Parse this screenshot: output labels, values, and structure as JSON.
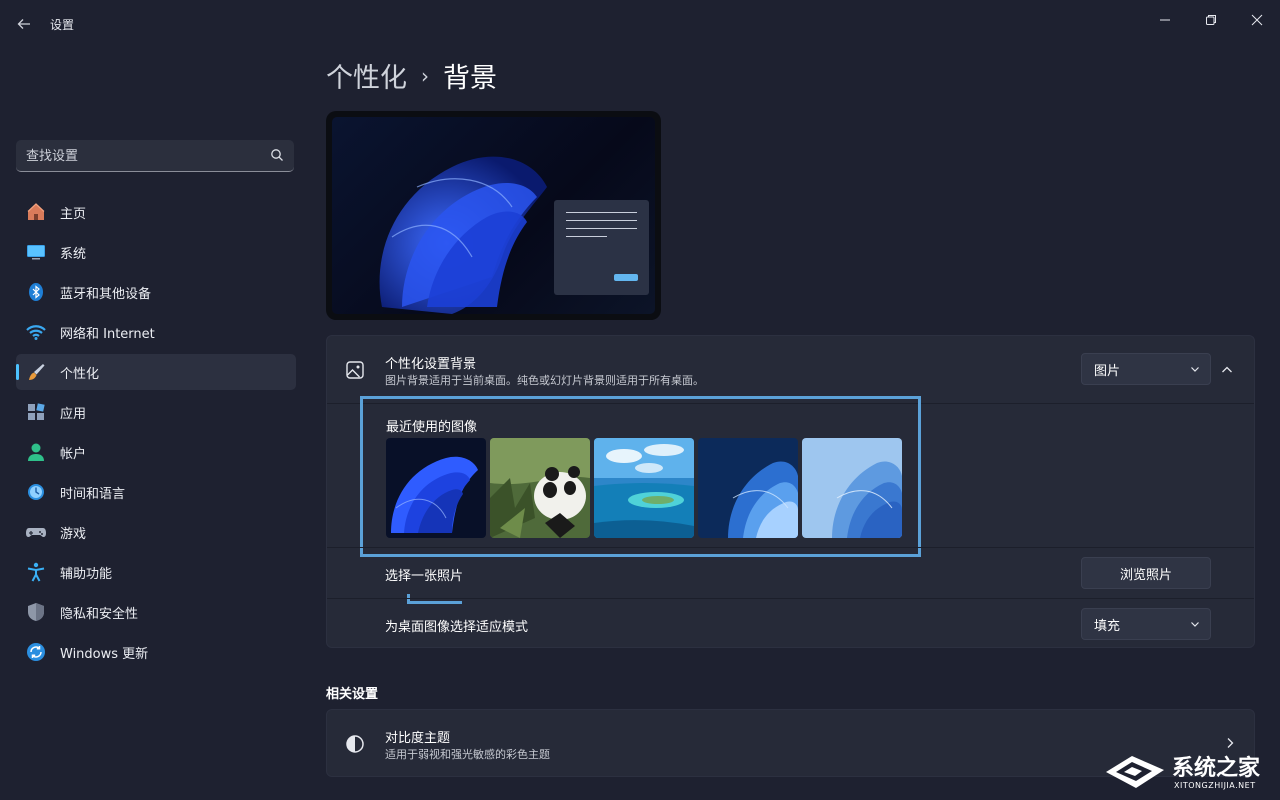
{
  "window": {
    "title": "设置",
    "controls": [
      "minimize-icon",
      "maximize-icon",
      "close-icon"
    ]
  },
  "search": {
    "placeholder": "查找设置"
  },
  "sidebar": {
    "items": [
      {
        "label": "主页",
        "icon": "home-icon",
        "active": false
      },
      {
        "label": "系统",
        "icon": "system-display-icon",
        "active": false
      },
      {
        "label": "蓝牙和其他设备",
        "icon": "bluetooth-icon",
        "active": false
      },
      {
        "label": "网络和 Internet",
        "icon": "wifi-icon",
        "active": false
      },
      {
        "label": "个性化",
        "icon": "brush-icon",
        "active": true
      },
      {
        "label": "应用",
        "icon": "apps-icon",
        "active": false
      },
      {
        "label": "帐户",
        "icon": "account-icon",
        "active": false
      },
      {
        "label": "时间和语言",
        "icon": "time-language-icon",
        "active": false
      },
      {
        "label": "游戏",
        "icon": "gamepad-icon",
        "active": false
      },
      {
        "label": "辅助功能",
        "icon": "accessibility-icon",
        "active": false
      },
      {
        "label": "隐私和安全性",
        "icon": "shield-icon",
        "active": false
      },
      {
        "label": "Windows 更新",
        "icon": "update-icon",
        "active": false
      }
    ]
  },
  "header": {
    "breadcrumb_parent": "个性化",
    "separator": "›",
    "title": "背景"
  },
  "background": {
    "title": "个性化设置背景",
    "subtitle": "图片背景适用于当前桌面。纯色或幻灯片背景则适用于所有桌面。",
    "type_value": "图片",
    "recent_title": "最近使用的图像",
    "recent_images": [
      {
        "name": "windows-bloom-dark",
        "icon": "wallpaper-bloom-dark"
      },
      {
        "name": "panda",
        "icon": "wallpaper-panda"
      },
      {
        "name": "ocean-island",
        "icon": "wallpaper-ocean"
      },
      {
        "name": "glow-dark",
        "icon": "wallpaper-glow-dark"
      },
      {
        "name": "glow-light",
        "icon": "wallpaper-glow-light"
      }
    ],
    "choose_photo_label": "选择一张照片",
    "browse_button": "浏览照片",
    "fit_label": "为桌面图像选择适应模式",
    "fit_value": "填充"
  },
  "related": {
    "heading": "相关设置",
    "items": [
      {
        "title": "对比度主题",
        "subtitle": "适用于弱视和强光敏感的彩色主题",
        "icon": "contrast-icon"
      }
    ]
  },
  "watermark": {
    "brand": "系统之家",
    "url": "XITONGZHIJIA.NET"
  },
  "colors": {
    "background": "#1e2130",
    "card": "#262a38",
    "accent": "#4cc2ff",
    "annotation": "#5ba1d8"
  }
}
